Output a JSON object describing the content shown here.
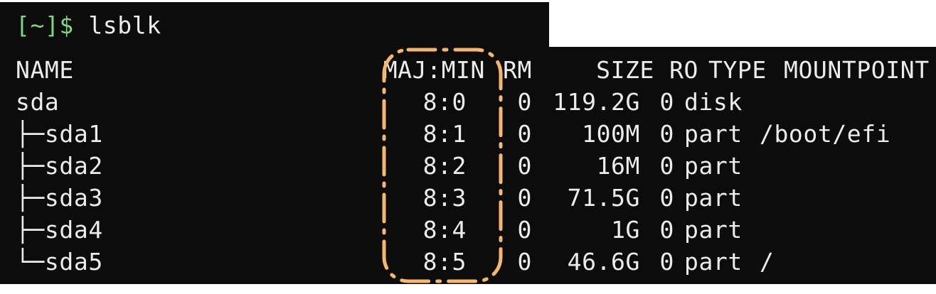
{
  "prompt": {
    "bracket_open": "[",
    "path": "~",
    "bracket_close": "]",
    "dollar": "$",
    "command": " lsblk"
  },
  "headers": {
    "name": "NAME",
    "majmin": "MAJ:MIN",
    "rm": "RM",
    "size": "SIZE",
    "ro": "RO",
    "type": "TYPE",
    "mountpoint": "MOUNTPOINT"
  },
  "rows": [
    {
      "name": "sda",
      "majmin": "8:0",
      "rm": "0",
      "size": "119.2G",
      "ro": "0",
      "type": "disk",
      "mountpoint": ""
    },
    {
      "name": "├─sda1",
      "majmin": "8:1",
      "rm": "0",
      "size": "100M",
      "ro": "0",
      "type": "part",
      "mountpoint": "/boot/efi"
    },
    {
      "name": "├─sda2",
      "majmin": "8:2",
      "rm": "0",
      "size": "16M",
      "ro": "0",
      "type": "part",
      "mountpoint": ""
    },
    {
      "name": "├─sda3",
      "majmin": "8:3",
      "rm": "0",
      "size": "71.5G",
      "ro": "0",
      "type": "part",
      "mountpoint": ""
    },
    {
      "name": "├─sda4",
      "majmin": "8:4",
      "rm": "0",
      "size": "1G",
      "ro": "0",
      "type": "part",
      "mountpoint": ""
    },
    {
      "name": "└─sda5",
      "majmin": "8:5",
      "rm": "0",
      "size": "46.6G",
      "ro": "0",
      "type": "part",
      "mountpoint": "/"
    }
  ],
  "colors": {
    "terminal_bg": "#0c0c0c",
    "text": "#ececec",
    "prompt_green": "#7dd77d",
    "highlight": "#f5b86a"
  }
}
